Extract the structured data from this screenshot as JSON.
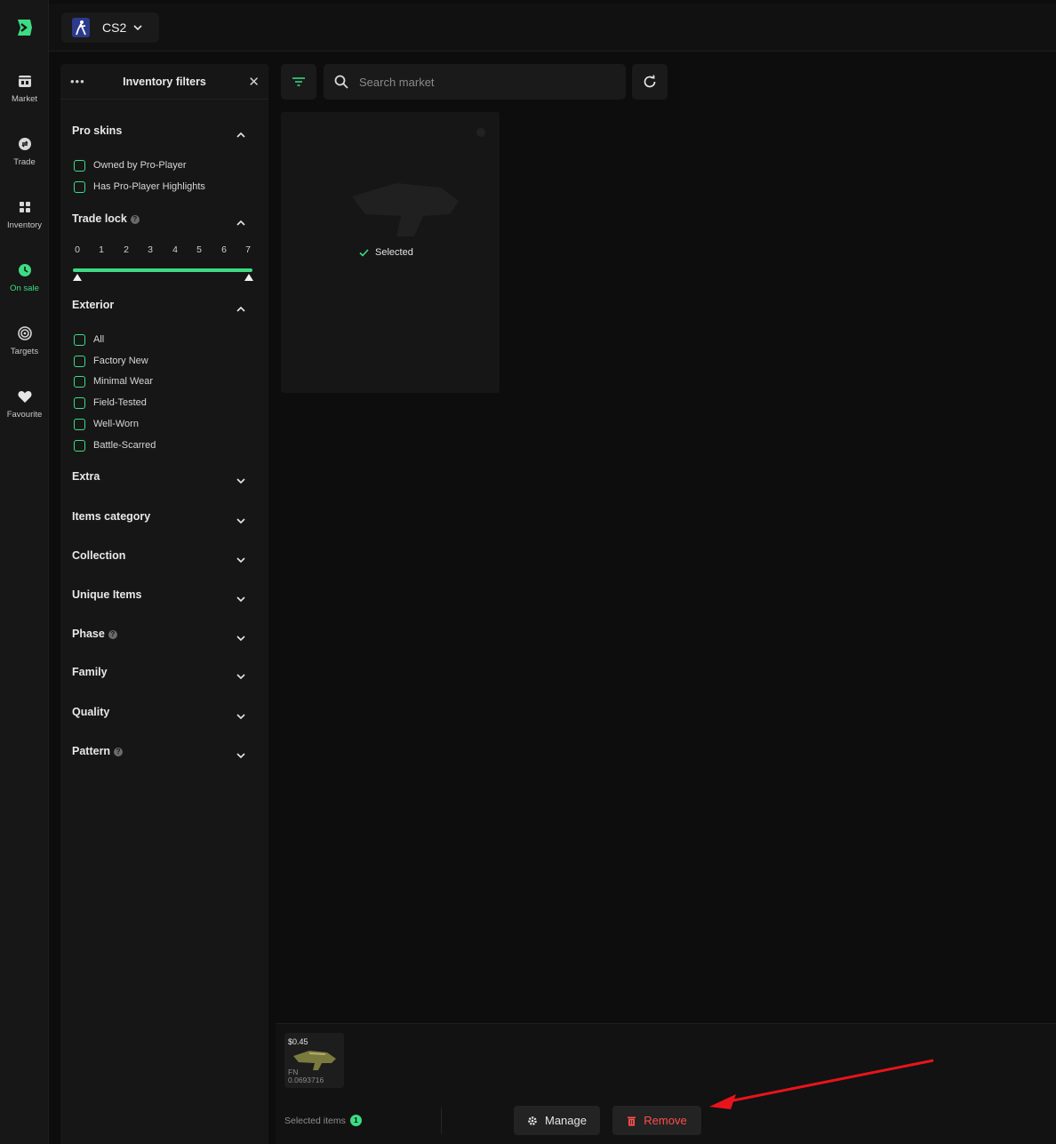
{
  "nav": {
    "items": [
      {
        "label": "Market",
        "icon": "market-icon"
      },
      {
        "label": "Trade",
        "icon": "trade-icon"
      },
      {
        "label": "Inventory",
        "icon": "inventory-icon"
      },
      {
        "label": "On sale",
        "icon": "on-sale-icon"
      },
      {
        "label": "Targets",
        "icon": "targets-icon"
      },
      {
        "label": "Favourite",
        "icon": "heart-icon"
      }
    ],
    "active": "On sale"
  },
  "header": {
    "game": "CS2"
  },
  "filters": {
    "title": "Inventory filters",
    "pro_skins": {
      "title": "Pro skins",
      "options": [
        "Owned by Pro-Player",
        "Has Pro-Player Highlights"
      ]
    },
    "trade_lock": {
      "title": "Trade lock",
      "ticks": [
        "0",
        "1",
        "2",
        "3",
        "4",
        "5",
        "6",
        "7"
      ],
      "range": [
        0,
        7
      ]
    },
    "exterior": {
      "title": "Exterior",
      "options": [
        "All",
        "Factory New",
        "Minimal Wear",
        "Field-Tested",
        "Well-Worn",
        "Battle-Scarred"
      ]
    },
    "collapsed_sections": [
      "Extra",
      "Items category",
      "Collection",
      "Unique Items",
      "Phase",
      "Family",
      "Quality",
      "Pattern"
    ]
  },
  "toolbar": {
    "search_placeholder": "Search market"
  },
  "card": {
    "selected_label": "Selected"
  },
  "selection": {
    "item_price": "$0.45",
    "item_exterior": "FN",
    "item_float": "0.0693716",
    "label": "Selected items",
    "count": "1",
    "manage_label": "Manage",
    "remove_label": "Remove"
  },
  "colors": {
    "accent": "#3ddc84",
    "danger": "#ff4d4d",
    "annotation_arrow": "#e8141b"
  }
}
